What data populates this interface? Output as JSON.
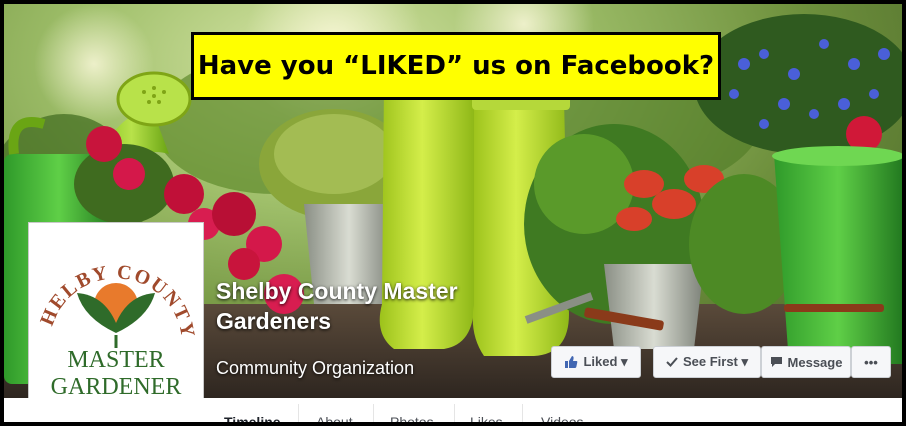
{
  "banner": {
    "text": "Have you “LIKED” us on Facebook?"
  },
  "page": {
    "name_line1": "Shelby County Master",
    "name_line2": "Gardeners",
    "category": "Community Organization"
  },
  "logo": {
    "arc_text": "SHELBY COUNTY",
    "line1": "MASTER",
    "line2": "GARDENER"
  },
  "actions": {
    "liked": "Liked ▾",
    "see_first": "See First ▾",
    "message": "Message",
    "more": "•••"
  },
  "tabs": [
    "Timeline",
    "About",
    "Photos",
    "Likes",
    "Videos"
  ],
  "colors": {
    "facebook_blue": "#4267b2",
    "banner_yellow": "#ffff00",
    "logo_green": "#2f6b2a",
    "logo_orange": "#e87a2c",
    "logo_rust": "#a04a2c"
  }
}
